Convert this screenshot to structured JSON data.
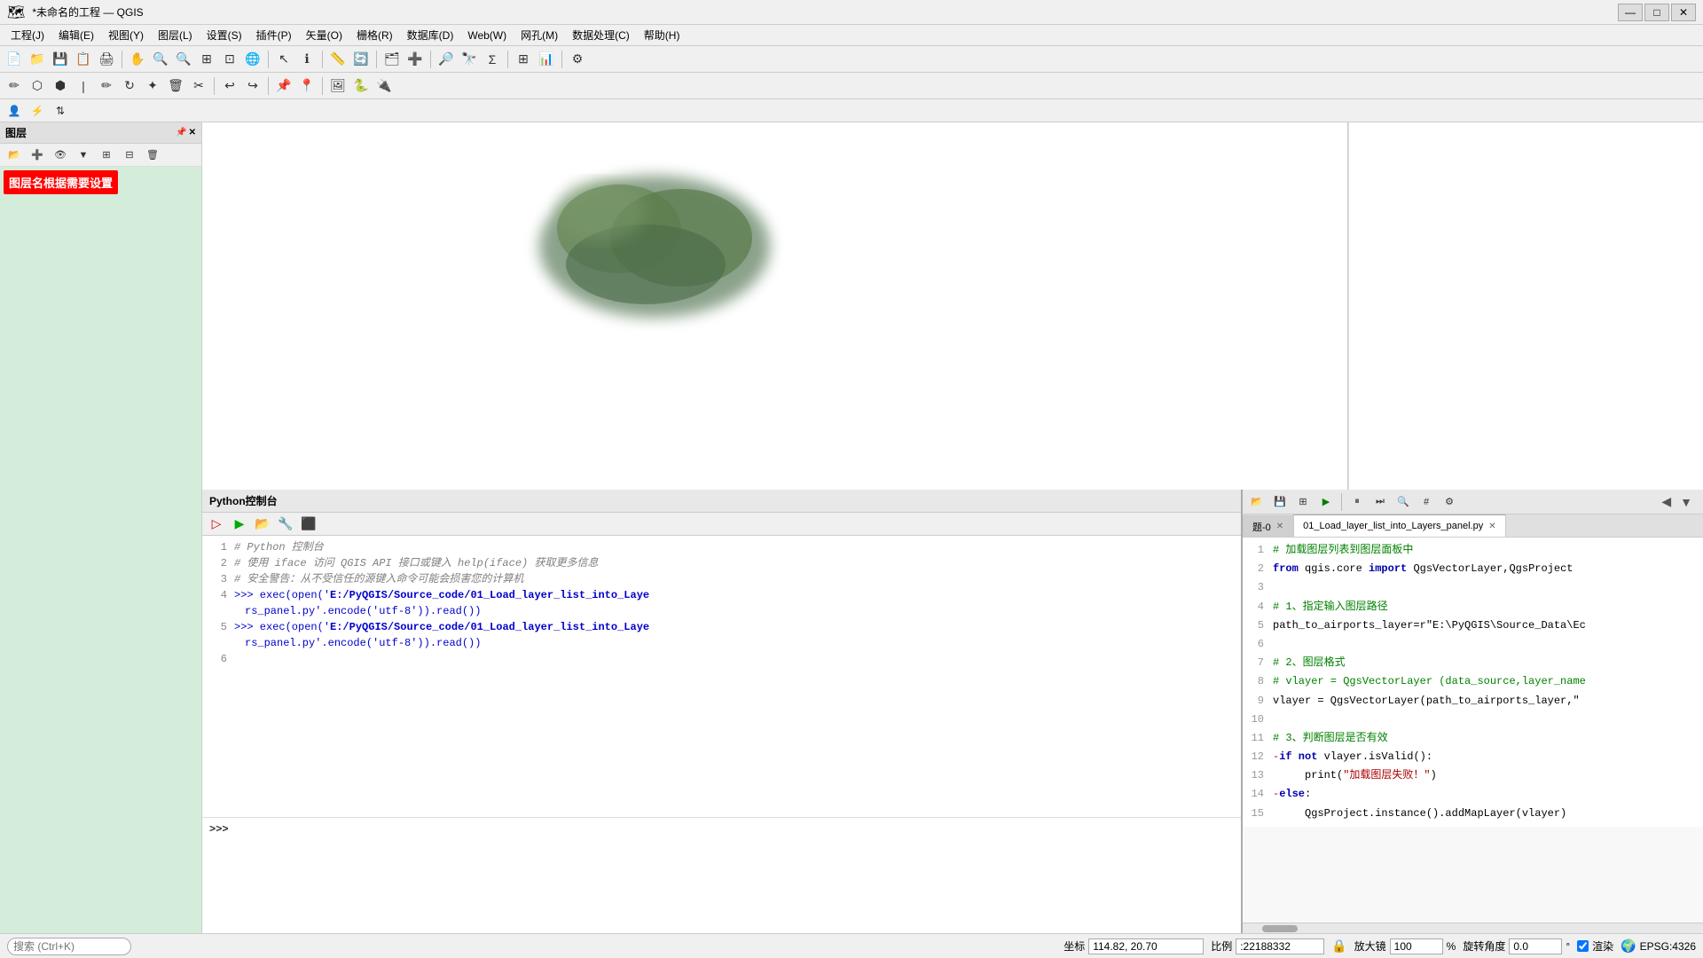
{
  "titleBar": {
    "title": "*未命名的工程 — QGIS",
    "minimize": "—",
    "maximize": "□",
    "close": "✕"
  },
  "menuBar": {
    "items": [
      "工程(J)",
      "编辑(E)",
      "视图(Y)",
      "图层(L)",
      "设置(S)",
      "插件(P)",
      "矢量(O)",
      "栅格(R)",
      "数据库(D)",
      "Web(W)",
      "网孔(M)",
      "数据处理(C)",
      "帮助(H)"
    ]
  },
  "sidebar": {
    "title": "图层",
    "layerName": "图层名根据需要设置"
  },
  "pythonConsole": {
    "title": "Python控制台",
    "lines": [
      {
        "num": 1,
        "text": "# Python 控制台",
        "type": "comment"
      },
      {
        "num": 2,
        "text": "# 使用 iface 访问 QGIS API 接口或键入 help(iface) 获取更多信息",
        "type": "comment"
      },
      {
        "num": 3,
        "text": "# 安全警告：从不受信任的源键入命令可能会损害您的计算机",
        "type": "comment"
      },
      {
        "num": 4,
        "text": ">>> exec(open('E:/PyQGIS/Source_code/01_Load_layer_list_into_Layers_panel.py'.encode('utf-8')).read())",
        "type": "exec"
      },
      {
        "num": 5,
        "text": ">>> exec(open('E:/PyQGIS/Source_code/01_Load_layer_list_into_Layers_panel.py'.encode('utf-8')).read())",
        "type": "exec"
      },
      {
        "num": 6,
        "text": "",
        "type": "normal"
      }
    ],
    "prompt": ">>>"
  },
  "editor": {
    "tabs": [
      {
        "label": "题-0",
        "active": false,
        "closable": true
      },
      {
        "label": "01_Load_layer_list_into_Layers_panel.py",
        "active": true,
        "closable": true
      }
    ],
    "lines": [
      {
        "num": 1,
        "text": "# 加载图层列表到图层面板中",
        "type": "comment"
      },
      {
        "num": 2,
        "text": "from qgis.core import QgsVectorLayer,QgsProject",
        "type": "code"
      },
      {
        "num": 3,
        "text": "",
        "type": "normal"
      },
      {
        "num": 4,
        "text": "# 1、指定输入图层路径",
        "type": "comment"
      },
      {
        "num": 5,
        "text": "path_to_airports_layer=r\"E:\\PyQGIS\\Source_Data\\Ec",
        "type": "code"
      },
      {
        "num": 6,
        "text": "",
        "type": "normal"
      },
      {
        "num": 7,
        "text": "# 2、图层格式",
        "type": "comment"
      },
      {
        "num": 8,
        "text": "# vlayer = QgsVectorLayer (data_source,layer_name",
        "type": "comment"
      },
      {
        "num": 9,
        "text": "vlayer = QgsVectorLayer(path_to_airports_layer,\"",
        "type": "code"
      },
      {
        "num": 10,
        "text": "",
        "type": "normal"
      },
      {
        "num": 11,
        "text": "# 3、判断图层是否有效",
        "type": "comment"
      },
      {
        "num": 12,
        "text": "-if not vlayer.isValid():",
        "type": "code"
      },
      {
        "num": 13,
        "text": "     print(\"加载图层失败！\")",
        "type": "code"
      },
      {
        "num": 14,
        "text": "-else:",
        "type": "code"
      },
      {
        "num": 15,
        "text": "     QgsProject.instance().addMapLayer(vlayer)",
        "type": "code"
      }
    ]
  },
  "statusBar": {
    "searchPlaceholder": "搜索 (Ctrl+K)",
    "coordLabel": "坐标",
    "coordValue": "114.82, 20.70",
    "scaleLabel": "比例",
    "scaleValue": ":22188332",
    "zoomLabel": "放大镜",
    "zoomValue": "100%",
    "rotationLabel": "旋转角度",
    "rotationValue": "0.0°",
    "renderLabel": "渲染",
    "epsgValue": "EPSG:4326",
    "lockIcon": "🔒"
  }
}
